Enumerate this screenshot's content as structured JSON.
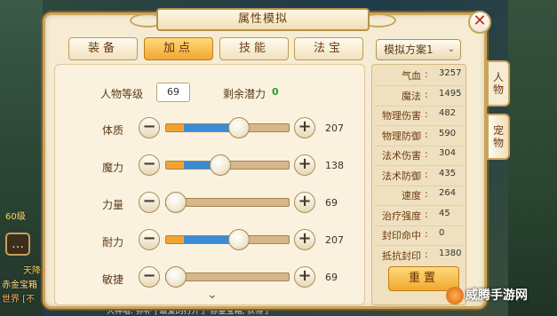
{
  "window": {
    "title": "属性模拟",
    "close_label": "✕"
  },
  "tabs": [
    {
      "label": "装备",
      "active": false
    },
    {
      "label": "加点",
      "active": true
    },
    {
      "label": "技能",
      "active": false
    },
    {
      "label": "法宝",
      "active": false
    }
  ],
  "character": {
    "level_label": "人物等级",
    "level_value": "69",
    "potential_label": "剩余潜力",
    "potential_value": "0"
  },
  "attributes": [
    {
      "label": "体质",
      "value": "207",
      "base_fraction": 0.14,
      "added_fraction": 0.37,
      "minus": "−",
      "plus": "+"
    },
    {
      "label": "魔力",
      "value": "138",
      "base_fraction": 0.14,
      "added_fraction": 0.22,
      "minus": "−",
      "plus": "+"
    },
    {
      "label": "力量",
      "value": "69",
      "base_fraction": 0.0,
      "added_fraction": 0.0,
      "minus": "−",
      "plus": "+"
    },
    {
      "label": "耐力",
      "value": "207",
      "base_fraction": 0.14,
      "added_fraction": 0.37,
      "minus": "−",
      "plus": "+"
    },
    {
      "label": "敏捷",
      "value": "69",
      "base_fraction": 0.0,
      "added_fraction": 0.0,
      "minus": "−",
      "plus": "+"
    }
  ],
  "scheme": {
    "label": "模拟方案1",
    "chevron": "⌄"
  },
  "stats": [
    {
      "name": "气血",
      "value": "3257"
    },
    {
      "name": "魔法",
      "value": "1495"
    },
    {
      "name": "物理伤害",
      "value": "482"
    },
    {
      "name": "物理防御",
      "value": "590"
    },
    {
      "name": "法术伤害",
      "value": "304"
    },
    {
      "name": "法术防御",
      "value": "435"
    },
    {
      "name": "速度",
      "value": "264"
    },
    {
      "name": "治疗强度",
      "value": "45"
    },
    {
      "name": "封印命中",
      "value": "0"
    },
    {
      "name": "抵抗封印",
      "value": "1380"
    }
  ],
  "stat_separator": ":",
  "reset_label": "重置",
  "side_tabs": [
    {
      "label": "人物",
      "active": true
    },
    {
      "label": "宠物",
      "active": false
    }
  ],
  "scroll_hint": "⌄",
  "background": {
    "left_lines": [
      "天降",
      "赤金宝箱",
      "世界 [不"
    ],
    "chat_icon": "…",
    "badge": "60级",
    "bottom_text": "大神墙: 弥补 | 敢爱的打开了 赤金宝箱, 获得了"
  },
  "watermark": "威腾手游网",
  "colors": {
    "accent_orange": "#f3a232",
    "accent_blue": "#3a8bd8",
    "panel_bg": "#f6ecd4",
    "close_red": "#c0281c",
    "potential_green": "#2e9c2a"
  }
}
